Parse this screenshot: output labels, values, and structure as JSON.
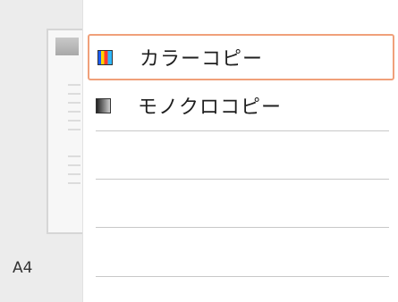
{
  "paper_size": "A4",
  "menu": {
    "items": [
      {
        "label": "カラーコピー",
        "icon": "color-copy-icon",
        "selected": true
      },
      {
        "label": "モノクロコピー",
        "icon": "mono-copy-icon",
        "selected": false
      }
    ]
  },
  "colors": {
    "selection_border": "#f0a07a",
    "panel_bg": "#ececec"
  }
}
